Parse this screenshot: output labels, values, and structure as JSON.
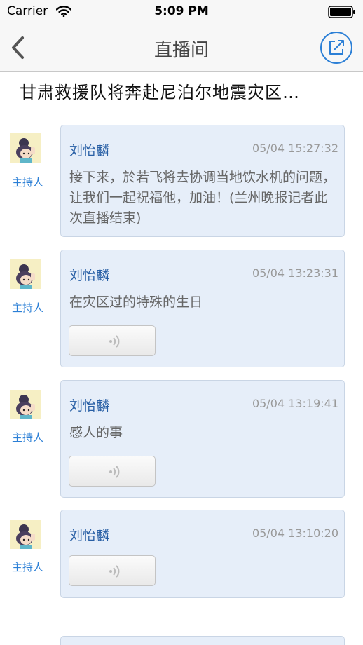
{
  "status_bar": {
    "carrier": "Carrier",
    "time": "5:09 PM"
  },
  "nav": {
    "title": "直播间"
  },
  "topic": {
    "title": "甘肃救援队将奔赴尼泊尔地震灾区…"
  },
  "messages": [
    {
      "role": "主持人",
      "name": "刘怡麟",
      "time": "05/04 15:27:32",
      "text": "接下来，於若飞将去协调当地饮水机的问题，让我们一起祝福他，加油！(兰州晚报记者此次直播结束)"
    },
    {
      "role": "主持人",
      "name": "刘怡麟",
      "time": "05/04 13:23:31",
      "text": "在灾区过的特殊的生日"
    },
    {
      "role": "主持人",
      "name": "刘怡麟",
      "time": "05/04 13:19:41",
      "text": "感人的事"
    },
    {
      "role": "主持人",
      "name": "刘怡麟",
      "time": "05/04 13:10:20",
      "text": ""
    }
  ],
  "icons": {
    "wifi": "wifi-icon",
    "battery": "battery-icon",
    "back": "chevron-left-icon",
    "share": "share-icon",
    "voice": "sound-wave-icon"
  },
  "colors": {
    "accent": "#2b7fd6",
    "bubble_bg": "#e6eef9",
    "name": "#285fa5"
  }
}
